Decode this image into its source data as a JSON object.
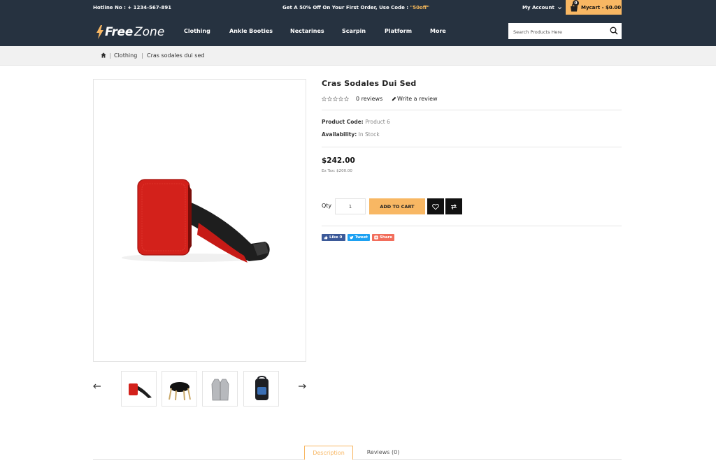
{
  "topbar": {
    "hotline": "Hotline No : + 1234-567-891",
    "promo_text": "Get A 50% Off On Your First Order, Use Code : ",
    "promo_code": "\"50off\"",
    "account_label": "My Account",
    "cart_count": "0",
    "cart_label": "Mycart - $0.00"
  },
  "header": {
    "logo_word1": "Free",
    "logo_word2": "Zone",
    "nav": [
      "Clothing",
      "Ankle Booties",
      "Nectarines",
      "Scarpin",
      "Platform",
      "More"
    ],
    "search_placeholder": "Search Products Here"
  },
  "breadcrumb": {
    "items": [
      "Clothing",
      "Cras sodales dui sed"
    ]
  },
  "product": {
    "title": "Cras Sodales Dui Sed",
    "rating": 0,
    "rating_max": 5,
    "reviews_label": "0 reviews",
    "write_review_label": "Write a review",
    "code_label": "Product Code:",
    "code_value": "Product 6",
    "availability_label": "Availability:",
    "availability_value": "In Stock",
    "price": "$242.00",
    "ex_tax": "Ex Tax: $200.00",
    "qty_label": "Qty",
    "qty_value": "1",
    "add_to_cart_label": "ADD TO CART",
    "social": {
      "like": "Like 0",
      "tweet": "Tweet",
      "share": "Share"
    }
  },
  "colors": {
    "dark": "#263240",
    "accent": "#f8b763",
    "facebook": "#3b5998",
    "twitter": "#1da1f2",
    "share": "#f26d5b"
  },
  "tabs": {
    "description": "Description",
    "reviews": "Reviews (0)"
  }
}
